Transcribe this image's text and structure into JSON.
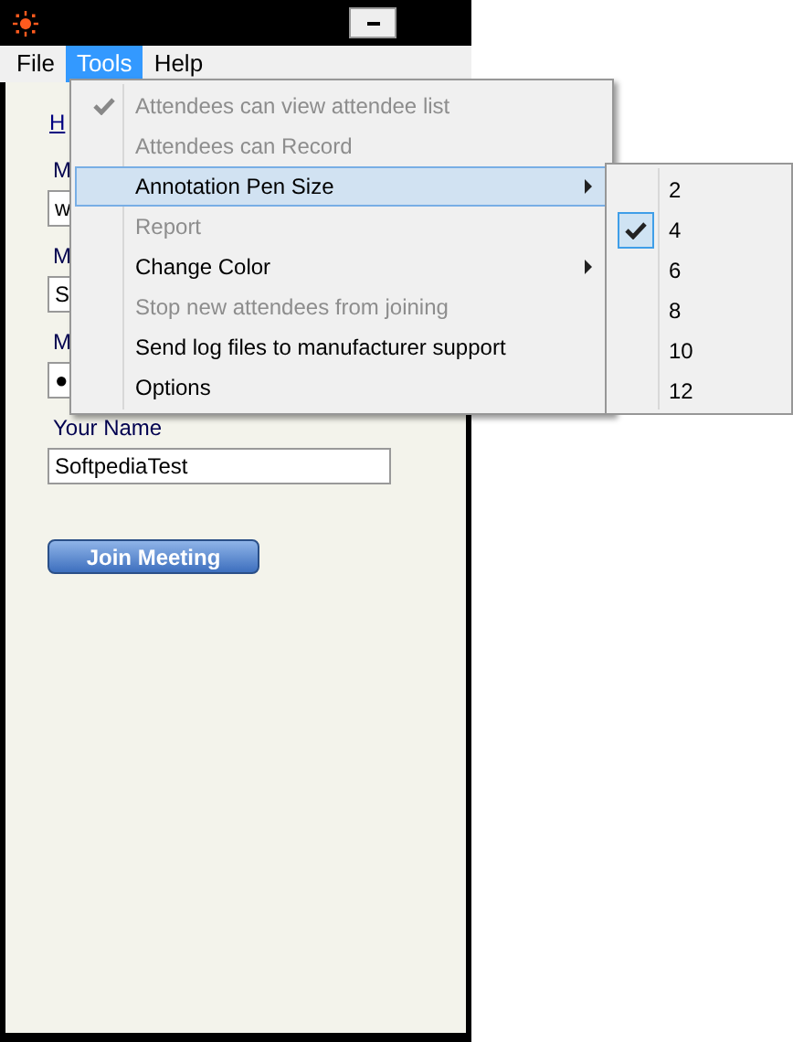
{
  "menubar": [
    {
      "label": "File",
      "selected": false
    },
    {
      "label": "Tools",
      "selected": true
    },
    {
      "label": "Help",
      "selected": false
    }
  ],
  "form": {
    "link": "H",
    "labels": [
      "M",
      "M",
      "M"
    ],
    "fields": [
      "w",
      "S",
      "●"
    ],
    "name_label": "Your Name",
    "name_value": "SoftpediaTest",
    "join_button": "Join Meeting"
  },
  "tools_menu": [
    {
      "label": "Attendees can view attendee list",
      "disabled": true,
      "checked": true,
      "submenu": false,
      "selected": false
    },
    {
      "label": "Attendees can Record",
      "disabled": true,
      "checked": false,
      "submenu": false,
      "selected": false
    },
    {
      "label": "Annotation Pen Size",
      "disabled": false,
      "checked": false,
      "submenu": true,
      "selected": true
    },
    {
      "label": "Report",
      "disabled": true,
      "checked": false,
      "submenu": false,
      "selected": false
    },
    {
      "label": "Change Color",
      "disabled": false,
      "checked": false,
      "submenu": true,
      "selected": false
    },
    {
      "label": "Stop new attendees from joining",
      "disabled": true,
      "checked": false,
      "submenu": false,
      "selected": false
    },
    {
      "label": "Send log files to manufacturer support",
      "disabled": false,
      "checked": false,
      "submenu": false,
      "selected": false
    },
    {
      "label": "Options",
      "disabled": false,
      "checked": false,
      "submenu": false,
      "selected": false
    }
  ],
  "pen_size_menu": [
    {
      "label": "2",
      "checked": false
    },
    {
      "label": "4",
      "checked": true
    },
    {
      "label": "6",
      "checked": false
    },
    {
      "label": "8",
      "checked": false
    },
    {
      "label": "10",
      "checked": false
    },
    {
      "label": "12",
      "checked": false
    }
  ]
}
